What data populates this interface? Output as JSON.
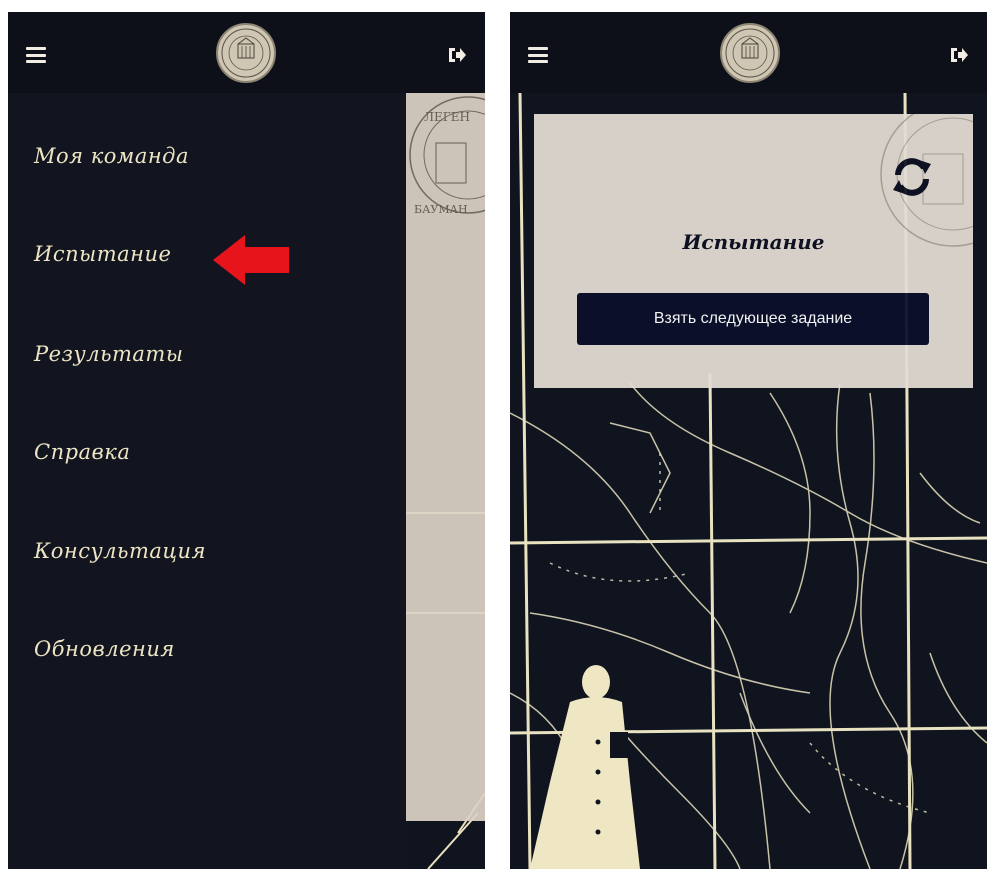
{
  "left_screen": {
    "menu": {
      "items": [
        {
          "label": "Моя команда"
        },
        {
          "label": "Испытание"
        },
        {
          "label": "Результаты"
        },
        {
          "label": "Справка"
        },
        {
          "label": "Консультация"
        },
        {
          "label": "Обновления"
        }
      ]
    },
    "annotation_arrow_color": "#e8141c"
  },
  "right_screen": {
    "challenge_card": {
      "title": "Испытание",
      "next_task_button": "Взять следующее задание"
    }
  },
  "topbar": {
    "menu_icon": "hamburger-icon",
    "logout_icon": "sign-out-icon",
    "logo": "legends-of-baumanka-logo",
    "logo_text": "ЛЕГЕНДЫ БАУМАНКИ"
  },
  "theme": {
    "background": "#10141f",
    "topbar": "#0d1018",
    "menu_text": "#ece4c4",
    "card": "#e3dcd4",
    "button": "#0b0f2a",
    "map_lines": "#e9e2c0"
  }
}
